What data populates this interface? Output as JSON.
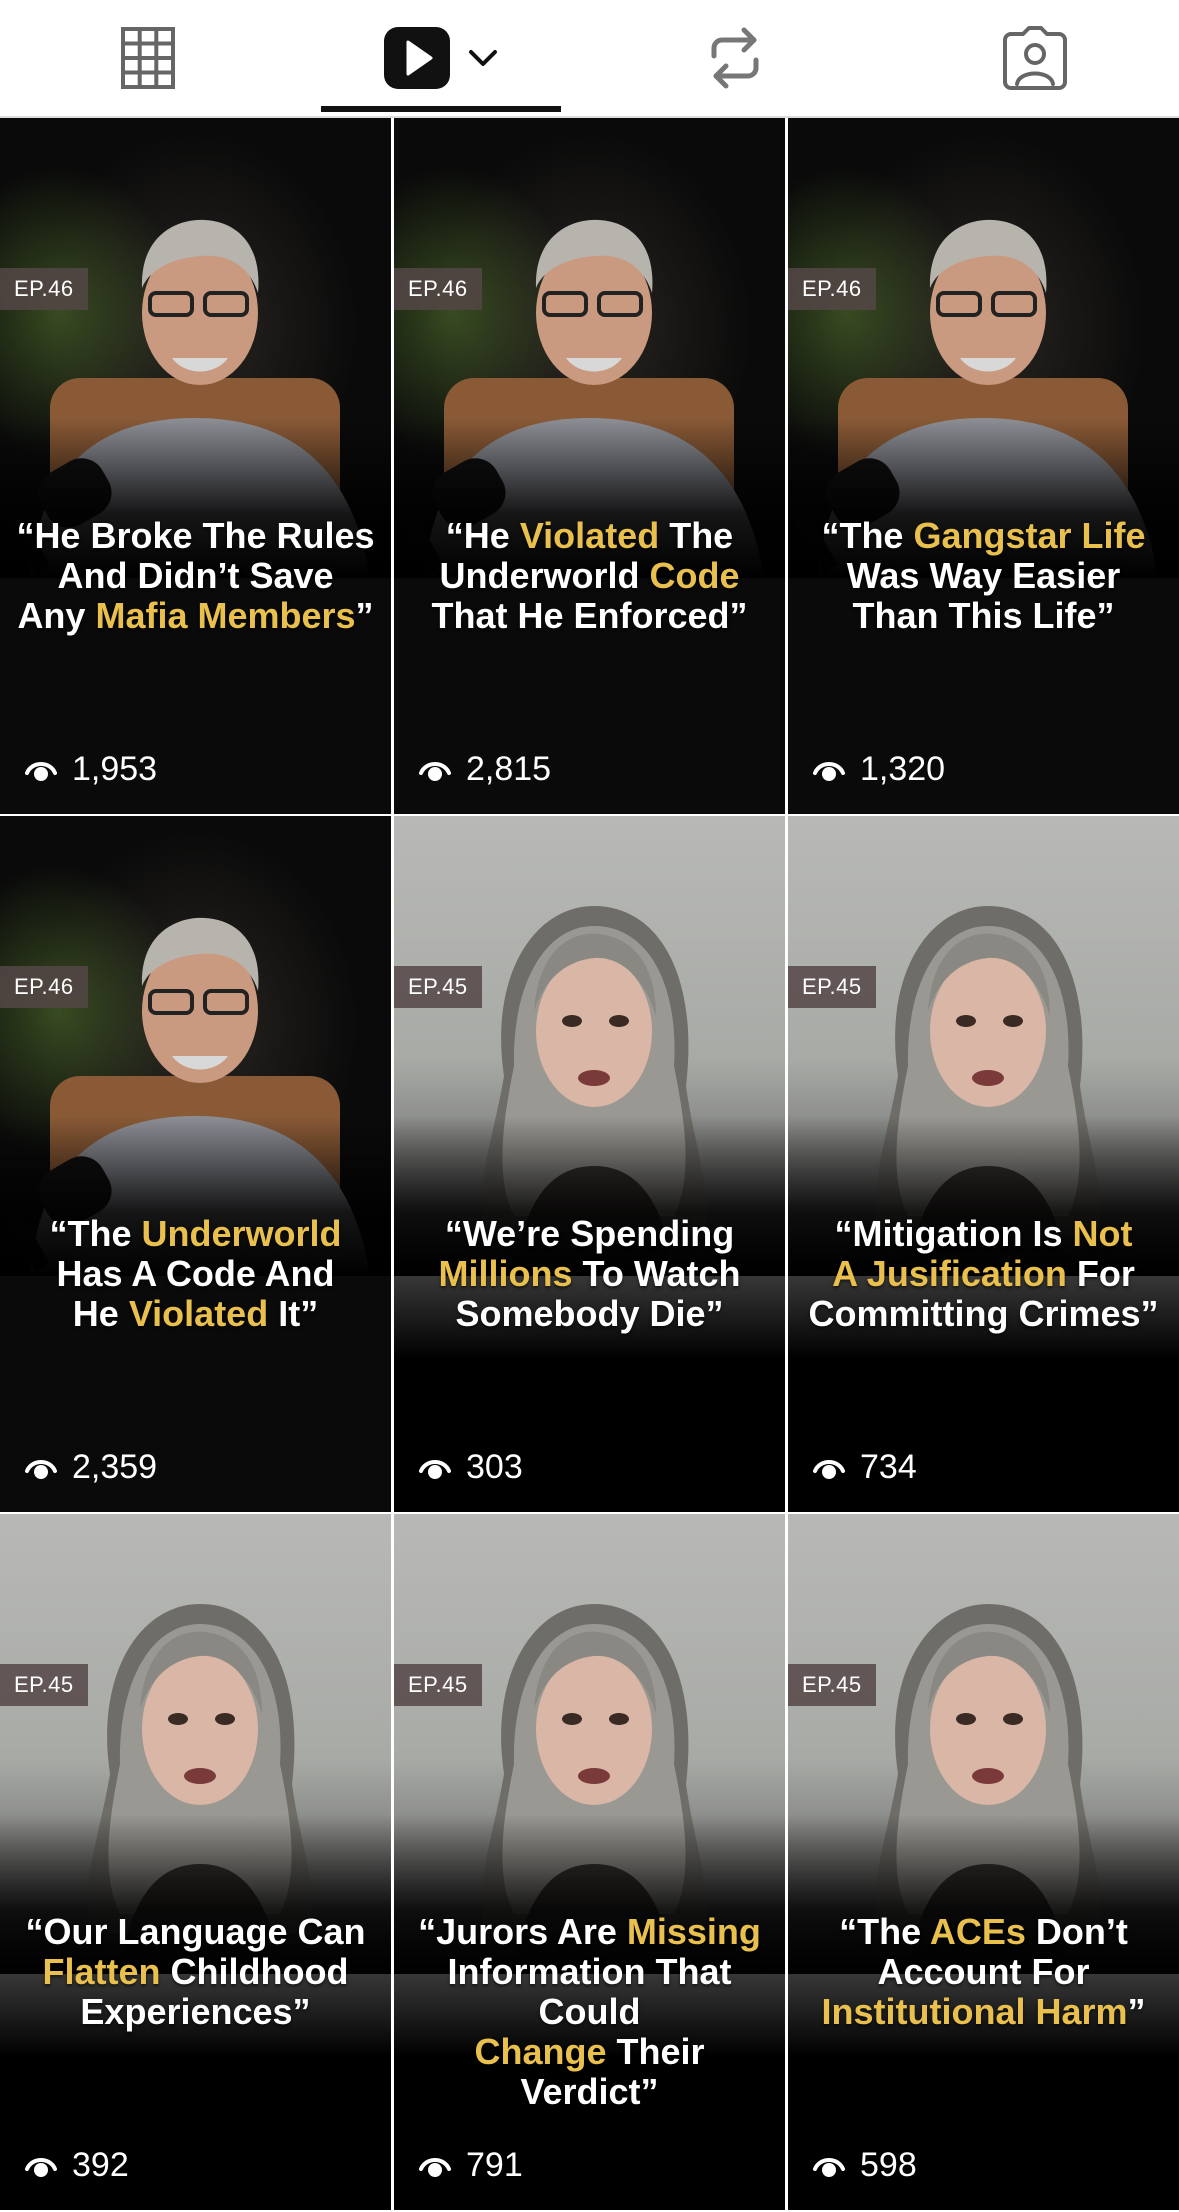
{
  "tabs": [
    {
      "name": "grid-icon"
    },
    {
      "name": "play-icon",
      "extra": "chevron-down-icon",
      "active": true
    },
    {
      "name": "repost-icon"
    },
    {
      "name": "tagged-user-icon"
    }
  ],
  "colors": {
    "highlight": "#e9c04d",
    "badge": "#554646"
  },
  "videos": [
    {
      "ep": "EP.46",
      "views": "1,953",
      "quote": [
        [
          "“He Broke The Rules"
        ],
        [
          "And Didn’t Save"
        ],
        [
          "Any ",
          {
            "hl": "Mafia Members"
          },
          "”"
        ]
      ]
    },
    {
      "ep": "EP.46",
      "views": "2,815",
      "quote": [
        [
          "“He ",
          {
            "hl": "Violated"
          },
          " The"
        ],
        [
          "Underworld ",
          {
            "hl": "Code"
          }
        ],
        [
          "That He Enforced”"
        ]
      ]
    },
    {
      "ep": "EP.46",
      "views": "1,320",
      "quote": [
        [
          "“The ",
          {
            "hl": "Gangstar Life"
          }
        ],
        [
          "Was Way Easier"
        ],
        [
          "Than This Life”"
        ]
      ]
    },
    {
      "ep": "EP.46",
      "views": "2,359",
      "quote": [
        [
          "“The ",
          {
            "hl": "Underworld"
          }
        ],
        [
          "Has A Code And"
        ],
        [
          "He ",
          {
            "hl": "Violated"
          },
          " It”"
        ]
      ]
    },
    {
      "ep": "EP.45",
      "views": "303",
      "quote": [
        [
          "“We’re Spending"
        ],
        [
          {
            "hl": "Millions"
          },
          " To Watch"
        ],
        [
          "Somebody Die”"
        ]
      ]
    },
    {
      "ep": "EP.45",
      "views": "734",
      "quote": [
        [
          "“Mitigation Is ",
          {
            "hl": "Not"
          }
        ],
        [
          {
            "hl": "A Jusification"
          },
          " For"
        ],
        [
          "Committing Crimes”"
        ]
      ]
    },
    {
      "ep": "EP.45",
      "views": "392",
      "quote": [
        [
          "“Our Language Can"
        ],
        [
          {
            "hl": "Flatten"
          },
          " Childhood"
        ],
        [
          "Experiences”"
        ]
      ]
    },
    {
      "ep": "EP.45",
      "views": "791",
      "quote": [
        [
          "“Jurors Are ",
          {
            "hl": "Missing"
          }
        ],
        [
          "Information That Could"
        ],
        [
          {
            "hl": "Change"
          },
          " Their Verdict”"
        ]
      ]
    },
    {
      "ep": "EP.45",
      "views": "598",
      "quote": [
        [
          "“The ",
          {
            "hl": "ACEs"
          },
          " Don’t"
        ],
        [
          "Account For"
        ],
        [
          {
            "hl": "Institutional Harm"
          },
          "”"
        ]
      ]
    }
  ]
}
